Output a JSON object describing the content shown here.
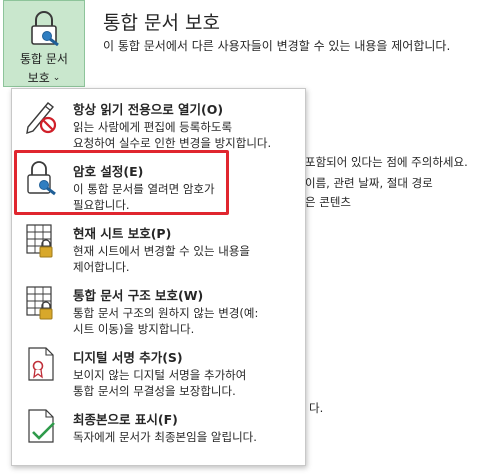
{
  "protect_button": {
    "line1": "통합 문서",
    "line2": "보호",
    "chevron": "⌄"
  },
  "section": {
    "title": "통합 문서 보호",
    "description": "이 통합 문서에서 다른 사용자들이 변경할 수 있는 내용을 제어합니다."
  },
  "background_text": {
    "line1": "포함되어 있다는 점에 주의하세요.",
    "line2": "이름, 관련 날짜, 절대 경로",
    "line3": "은 콘텐츠",
    "line4": "다."
  },
  "menu": {
    "items": [
      {
        "title": "항상 읽기 전용으로 열기(O)",
        "desc": [
          "읽는 사람에게 편집에 등록하도록",
          "요청하여 실수로 인한 변경을 방지합니다."
        ],
        "icon": "read-only-pencil-icon"
      },
      {
        "title": "암호 설정(E)",
        "desc": [
          "이 통합 문서를 열려면 암호가",
          "필요합니다."
        ],
        "icon": "lock-key-icon"
      },
      {
        "title": "현재 시트 보호(P)",
        "desc": [
          "현재 시트에서 변경할 수 있는 내용을",
          "제어합니다."
        ],
        "icon": "protect-sheet-icon"
      },
      {
        "title": "통합 문서 구조 보호(W)",
        "desc": [
          "통합 문서 구조의 원하지 않는 변경(예:",
          "시트 이동)을 방지합니다."
        ],
        "icon": "protect-structure-icon"
      },
      {
        "title": "디지털 서명 추가(S)",
        "desc": [
          "보이지 않는 디지털 서명을 추가하여",
          "통합 문서의 무결성을 보장합니다."
        ],
        "icon": "digital-signature-icon"
      },
      {
        "title": "최종본으로 표시(F)",
        "desc": [
          "독자에게 문서가 최종본임을 알립니다."
        ],
        "icon": "mark-final-icon"
      }
    ]
  },
  "colors": {
    "button_bg": "#c9e7cd",
    "highlight": "#e0262f",
    "lock_gold": "#d8a82b"
  }
}
